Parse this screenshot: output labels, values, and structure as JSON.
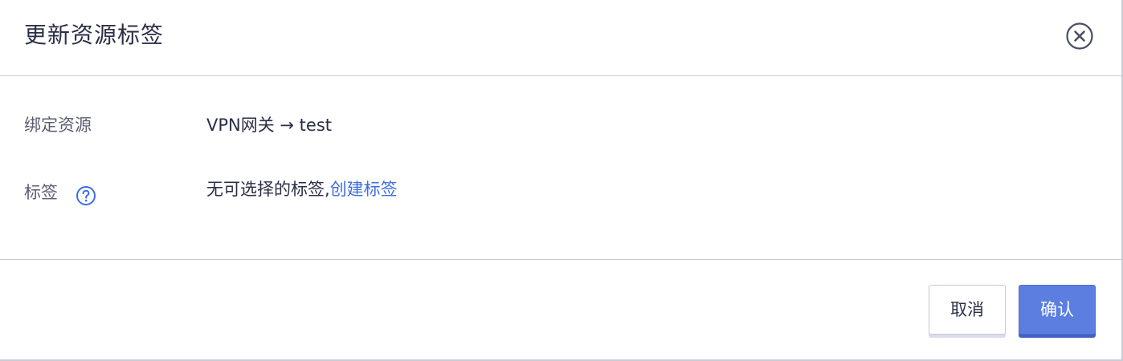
{
  "dialog": {
    "title": "更新资源标签",
    "close_icon": "close-circle-icon"
  },
  "fields": {
    "resource_label": "绑定资源",
    "resource_value": "VPN网关 → test",
    "tag_label": "标签",
    "tag_help_icon": "question-circle-icon",
    "tag_empty_text": "无可选择的标签,",
    "tag_create_link": "创建标签"
  },
  "footer": {
    "cancel_label": "取消",
    "confirm_label": "确认"
  },
  "colors": {
    "accent": "#5b7ee0",
    "link": "#3d6ee0",
    "text": "#2a2f45",
    "muted": "#5a6072"
  }
}
